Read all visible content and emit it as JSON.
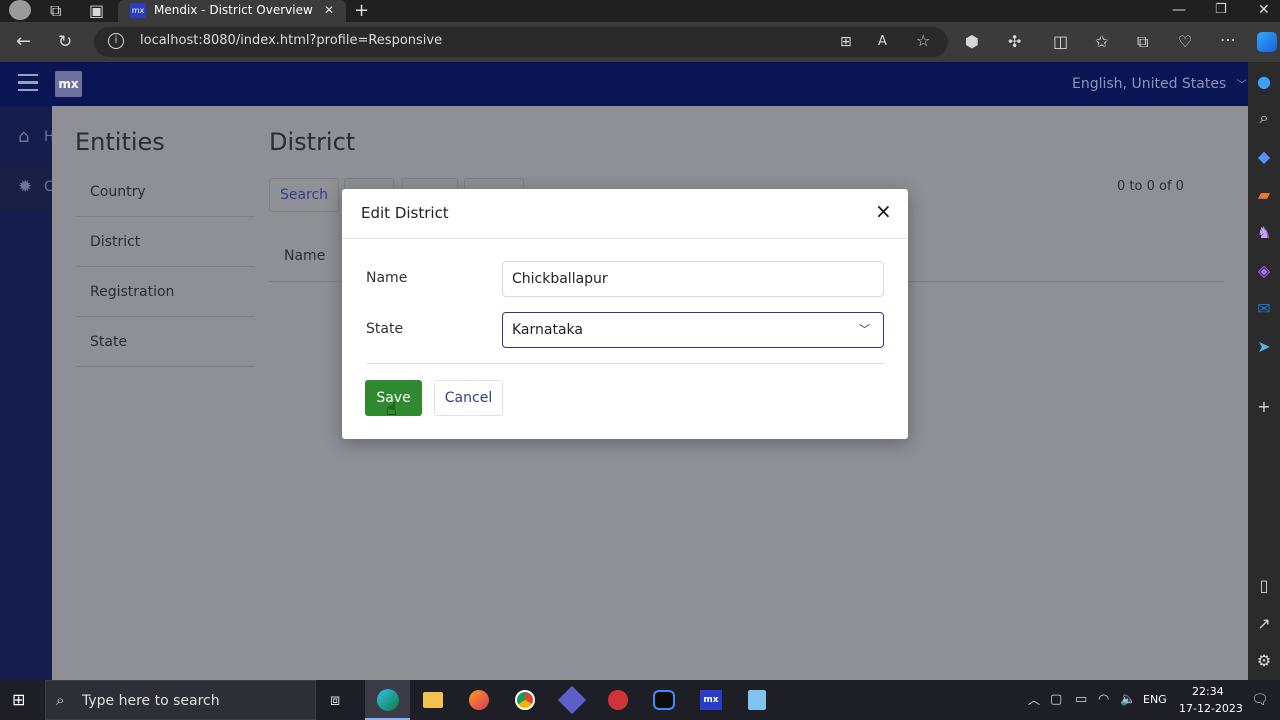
{
  "browser": {
    "tab_title": "Mendix - District Overview",
    "tab_close": "✕",
    "new_tab": "+",
    "url": "localhost:8080/index.html?profile=Responsive"
  },
  "app": {
    "logo": "mx",
    "language": "English, United States",
    "sidenav_items": [
      {
        "label": "H",
        "icon": "home-icon"
      },
      {
        "label": "C",
        "icon": "gear-icon"
      }
    ],
    "entities_title": "Entities",
    "entities": [
      "Country",
      "District",
      "Registration",
      "State"
    ],
    "page_title": "District",
    "search_button": "Search",
    "paging": "0 to 0 of 0",
    "column_name": "Name"
  },
  "modal": {
    "title": "Edit District",
    "close": "×",
    "name_label": "Name",
    "name_value": "Chickballapur",
    "state_label": "State",
    "state_value": "Karnataka",
    "save_label": "Save",
    "cancel_label": "Cancel"
  },
  "taskbar": {
    "search_placeholder": "Type here to search",
    "lang": "ENG",
    "time": "22:34",
    "date": "17-12-2023"
  }
}
